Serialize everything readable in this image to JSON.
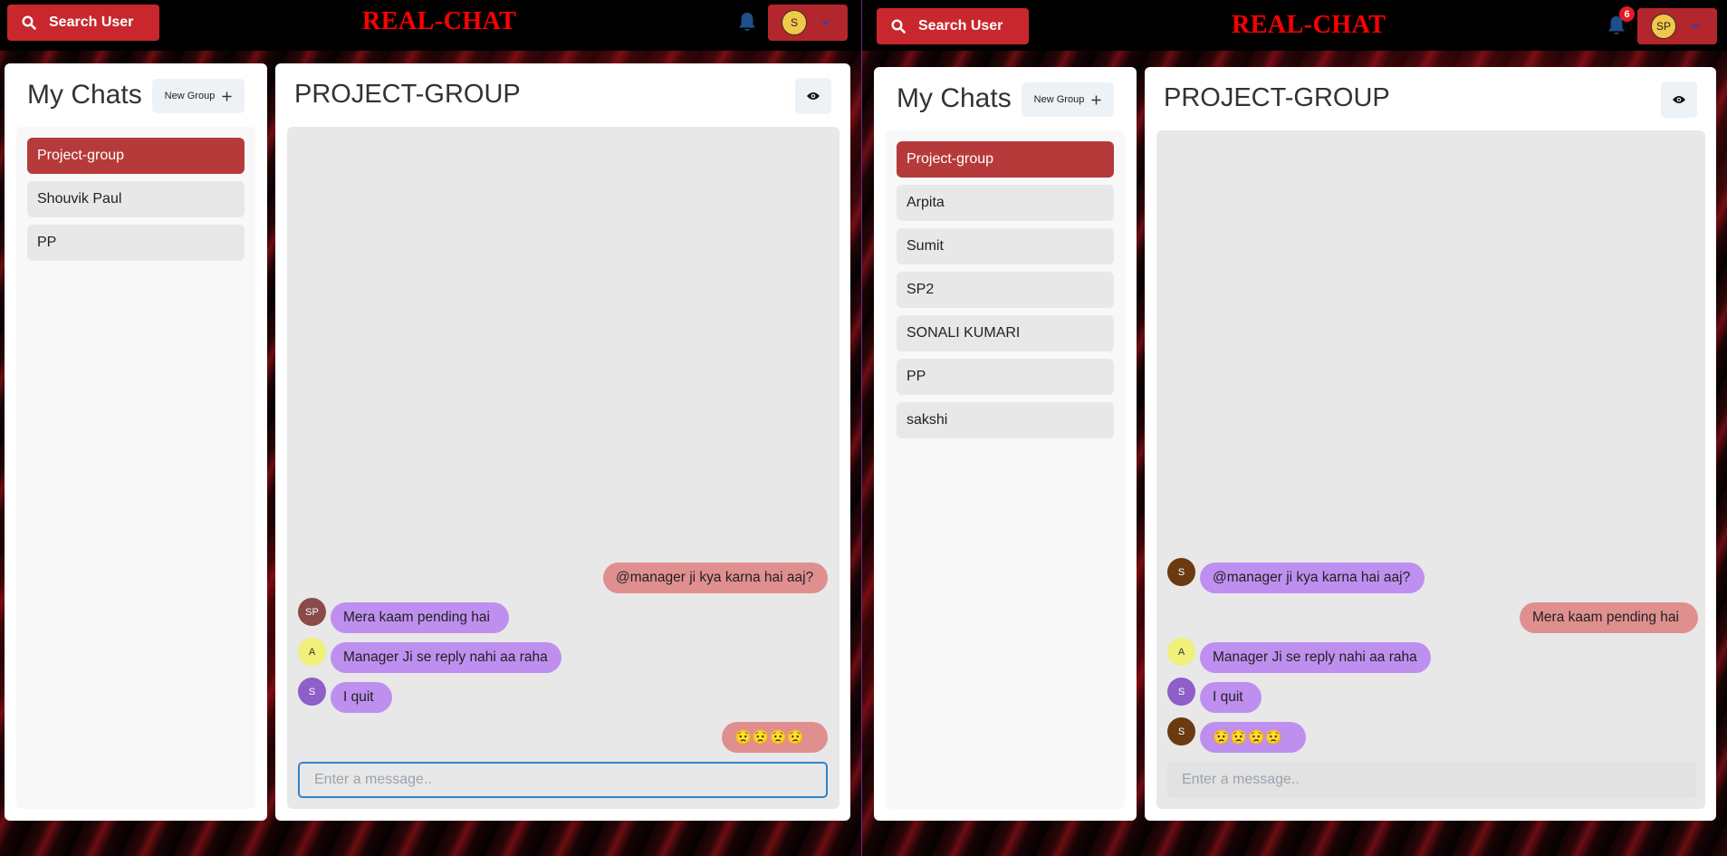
{
  "left": {
    "search_label": "Search User",
    "brand": "REAL-CHAT",
    "avatar_initials": "S",
    "my_chats_title": "My Chats",
    "new_group_label": "New Group",
    "chat_list": [
      "Project-group",
      "Shouvik Paul",
      "PP"
    ],
    "chat_title": "PROJECT-GROUP",
    "messages": [
      {
        "text": "@manager ji kya karna hai aaj?",
        "mine": true,
        "avatar": ""
      },
      {
        "text": "Mera kaam pending hai",
        "mine": false,
        "avatar": "SP"
      },
      {
        "text": "Manager Ji se reply nahi aa raha",
        "mine": false,
        "avatar": "A"
      },
      {
        "text": "I quit",
        "mine": false,
        "avatar": "S"
      },
      {
        "text": "😟😟😟😟",
        "mine": true,
        "avatar": ""
      }
    ],
    "input_placeholder": "Enter a message.."
  },
  "right": {
    "search_label": "Search User",
    "brand": "REAL-CHAT",
    "notification_count": "6",
    "avatar_initials": "SP",
    "my_chats_title": "My Chats",
    "new_group_label": "New Group",
    "chat_list": [
      "Project-group",
      "Arpita",
      "Sumit",
      "SP2",
      "SONALI KUMARI",
      "PP",
      "sakshi"
    ],
    "chat_title": "PROJECT-GROUP",
    "messages": [
      {
        "text": "@manager ji kya karna hai aaj?",
        "mine": false,
        "avatar": "S"
      },
      {
        "text": "Mera kaam pending hai",
        "mine": true,
        "avatar": ""
      },
      {
        "text": "Manager Ji se reply nahi aa raha",
        "mine": false,
        "avatar": "A"
      },
      {
        "text": "I quit",
        "mine": false,
        "avatar": "S"
      },
      {
        "text": "😟😟😟😟",
        "mine": false,
        "avatar": "S"
      }
    ],
    "input_placeholder": "Enter a message.."
  },
  "colors": {
    "accent": "#c8282d",
    "active_chat": "#b63a3a",
    "my_bubble": "#e08f8f",
    "their_bubble": "#bf8ff0",
    "brand": "#ff0000"
  },
  "icons": [
    "search-icon",
    "bell-icon",
    "chevron-down-icon",
    "plus-icon",
    "eye-icon"
  ]
}
